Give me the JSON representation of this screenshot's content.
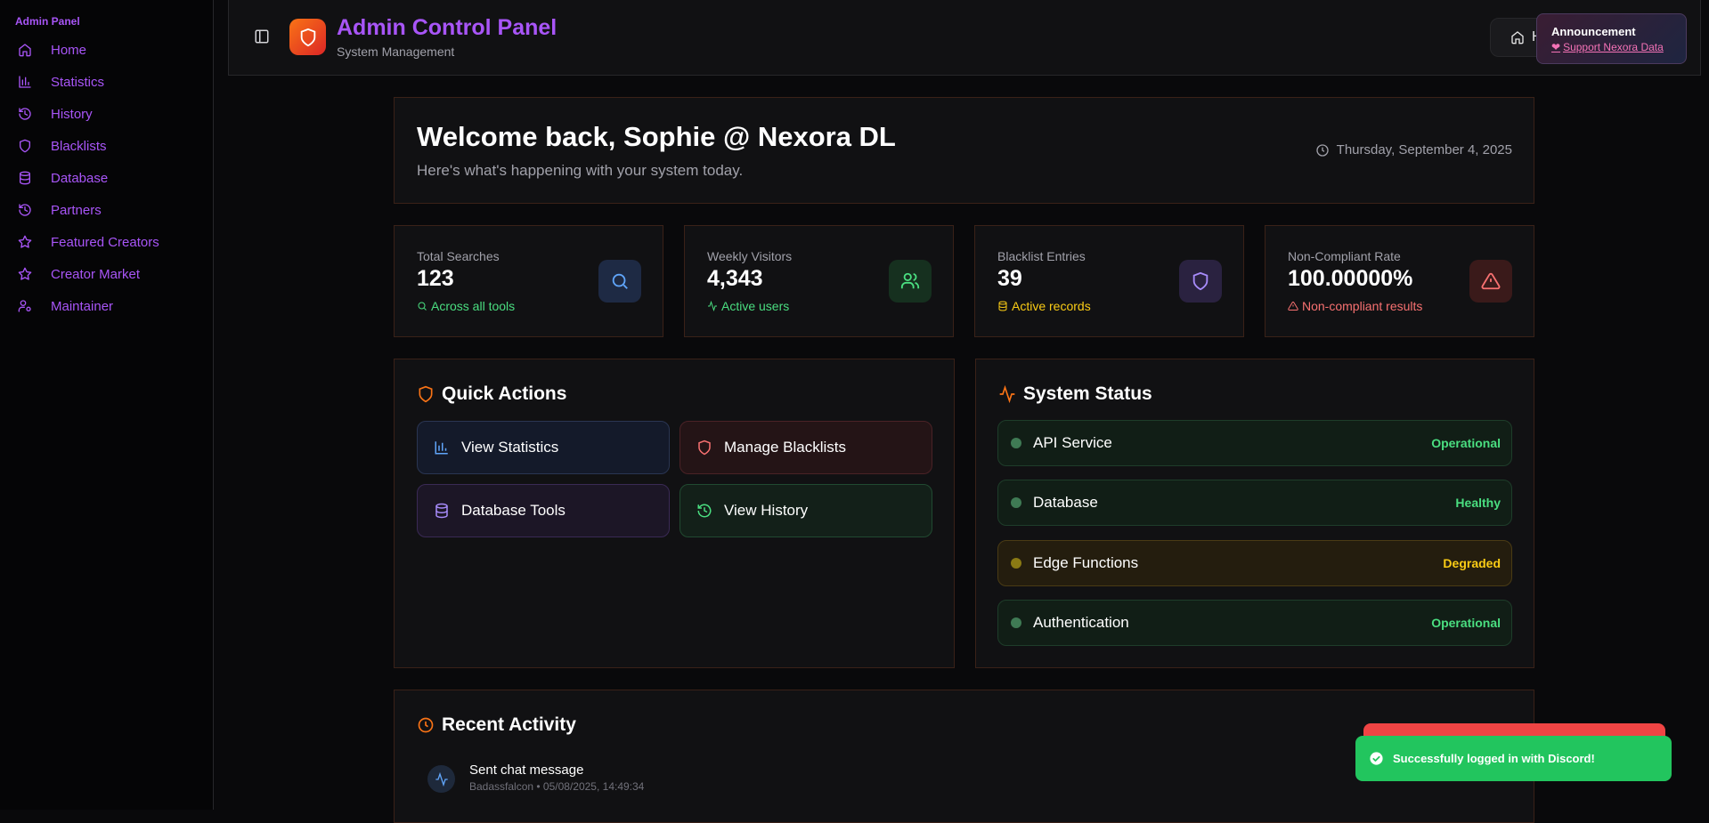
{
  "sidebar": {
    "title": "Admin Panel",
    "items": [
      {
        "label": "Home",
        "icon": "home-icon"
      },
      {
        "label": "Statistics",
        "icon": "bar-chart-icon"
      },
      {
        "label": "History",
        "icon": "history-icon"
      },
      {
        "label": "Blacklists",
        "icon": "shield-icon"
      },
      {
        "label": "Database",
        "icon": "database-icon"
      },
      {
        "label": "Partners",
        "icon": "history-icon"
      },
      {
        "label": "Featured Creators",
        "icon": "star-icon"
      },
      {
        "label": "Creator Market",
        "icon": "star-icon"
      },
      {
        "label": "Maintainer",
        "icon": "user-cog-icon"
      }
    ]
  },
  "header": {
    "title": "Admin Control Panel",
    "subtitle": "System Management",
    "home_label": "H"
  },
  "announcement": {
    "title": "Announcement",
    "link": "Support Nexora Data"
  },
  "welcome": {
    "heading": "Welcome back, Sophie @ Nexora DL",
    "subtext": "Here's what's happening with your system today.",
    "date": "Thursday, September 4, 2025"
  },
  "stats": [
    {
      "label": "Total Searches",
      "value": "123",
      "sub": "Across all tools",
      "sub_color": "#4ade80",
      "icon": "search-icon"
    },
    {
      "label": "Weekly Visitors",
      "value": "4,343",
      "sub": "Active users",
      "sub_color": "#4ade80",
      "icon": "users-icon"
    },
    {
      "label": "Blacklist Entries",
      "value": "39",
      "sub": "Active records",
      "sub_color": "#facc15",
      "icon": "shield-icon"
    },
    {
      "label": "Non-Compliant Rate",
      "value": "100.00000%",
      "sub": "Non-compliant results",
      "sub_color": "#f87171",
      "icon": "alert-triangle-icon"
    }
  ],
  "quick_actions": {
    "title": "Quick Actions",
    "buttons": [
      {
        "label": "View Statistics",
        "icon": "bar-chart-icon"
      },
      {
        "label": "Manage Blacklists",
        "icon": "shield-icon"
      },
      {
        "label": "Database Tools",
        "icon": "database-icon"
      },
      {
        "label": "View History",
        "icon": "history-icon"
      }
    ]
  },
  "system_status": {
    "title": "System Status",
    "services": [
      {
        "name": "API Service",
        "status": "Operational",
        "color": "#4ade80"
      },
      {
        "name": "Database",
        "status": "Healthy",
        "color": "#4ade80"
      },
      {
        "name": "Edge Functions",
        "status": "Degraded",
        "color": "#facc15"
      },
      {
        "name": "Authentication",
        "status": "Operational",
        "color": "#4ade80"
      }
    ]
  },
  "recent_activity": {
    "title": "Recent Activity",
    "items": [
      {
        "title": "Sent chat message",
        "meta": "Badassfalcon • 05/08/2025, 14:49:34"
      }
    ]
  },
  "toast": {
    "message": "Successfully logged in with Discord!"
  }
}
